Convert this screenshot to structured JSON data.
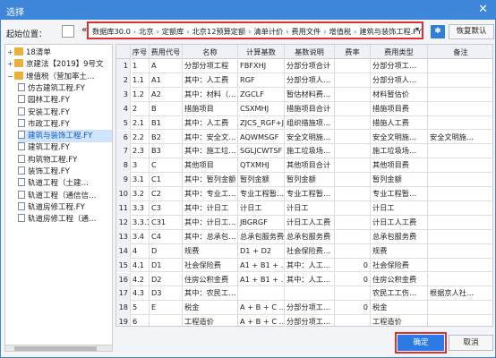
{
  "window": {
    "title": "选择",
    "close_glyph": "✕"
  },
  "path": {
    "label": "起始位置：",
    "arrow": "«",
    "crumbs": [
      "数据库30.0",
      "北京",
      "定额库",
      "北京12预算定额",
      "清单计价",
      "费用文件",
      "增值税",
      "建筑与装饰工程.FY"
    ],
    "separator": "›",
    "dropdown_glyph": "▾",
    "pin_glyph": "✱",
    "restore_label": "恢复默认"
  },
  "tree": {
    "items": [
      {
        "label": "18清单",
        "icon": "folder-icon",
        "level": 0,
        "expand": "+"
      },
      {
        "label": "京建法【2019】9号文",
        "icon": "folder-icon",
        "level": 0,
        "expand": "+"
      },
      {
        "label": "增值税（营加率土…",
        "icon": "folder-icon",
        "level": 0,
        "expand": "−"
      },
      {
        "label": "仿古建筑工程.FY",
        "icon": "file-icon",
        "level": 1
      },
      {
        "label": "园林工程.FY",
        "icon": "file-icon",
        "level": 1
      },
      {
        "label": "安装工程.FY",
        "icon": "file-icon",
        "level": 1
      },
      {
        "label": "市政工程.FY",
        "icon": "file-icon",
        "level": 1
      },
      {
        "label": "建筑与装饰工程.FY",
        "icon": "file-icon",
        "level": 1,
        "selected": true
      },
      {
        "label": "建筑工程.FY",
        "icon": "file-icon",
        "level": 1
      },
      {
        "label": "构筑物工程.FY",
        "icon": "file-icon",
        "level": 1
      },
      {
        "label": "装饰工程.FY",
        "icon": "file-icon",
        "level": 1
      },
      {
        "label": "轨道工程（土建…",
        "icon": "file-icon",
        "level": 1
      },
      {
        "label": "轨道工程（通信信…",
        "icon": "file-icon",
        "level": 1
      },
      {
        "label": "轨道房修工程.FY",
        "icon": "file-icon",
        "level": 1
      },
      {
        "label": "轨道房修工程（通…",
        "icon": "file-icon",
        "level": 1
      }
    ]
  },
  "grid": {
    "columns": [
      "序号",
      "费用代号",
      "名称",
      "计算基数",
      "基数说明",
      "费率",
      "费用类型",
      "备注"
    ],
    "rows": [
      [
        "1",
        "1",
        "A",
        "分部分项工程",
        "FBFXHJ",
        "分部分项合计",
        "",
        "分部分项工…",
        ""
      ],
      [
        "2",
        "1.1",
        "A1",
        "其中：人工费",
        "RGF",
        "分部分项人…",
        "",
        "分部分项人…",
        ""
      ],
      [
        "3",
        "1.2",
        "A2",
        "其中：材料（…",
        "ZGCLF",
        "暂估材料费…",
        "",
        "材料暂估价",
        ""
      ],
      [
        "4",
        "2",
        "B",
        "措施项目",
        "CSXMHJ",
        "措施项目合计",
        "",
        "措施项目费",
        ""
      ],
      [
        "5",
        "2.1",
        "B1",
        "其中：人工费",
        "ZJCS_RGF+J…",
        "组织措施项…",
        "",
        "措施人工费",
        ""
      ],
      [
        "6",
        "2.2",
        "B2",
        "其中：安全文…",
        "AQWMSGF",
        "安全文明施…",
        "",
        "安全文明施…",
        "安全文明施…"
      ],
      [
        "7",
        "2.3",
        "B3",
        "其中：施工垃…",
        "SGLJCWTSF",
        "施工垃圾场…",
        "",
        "施工垃圾场…",
        ""
      ],
      [
        "8",
        "3",
        "C",
        "其他项目",
        "QTXMHJ",
        "其他项目合计",
        "",
        "其他项目费",
        ""
      ],
      [
        "9",
        "3.1",
        "C1",
        "其中：暂列金额",
        "暂列金额",
        "暂列金额",
        "",
        "暂列金额",
        ""
      ],
      [
        "10",
        "3.2",
        "C2",
        "其中：专业工…",
        "专业工程暂…",
        "专业工程暂…",
        "",
        "专业工程暂…",
        ""
      ],
      [
        "11",
        "3.3",
        "C3",
        "其中：计日工",
        "计日工",
        "计日工",
        "",
        "计日工",
        ""
      ],
      [
        "12",
        "3.3.1",
        "C31",
        "其中：计日工…",
        "JBGRGF",
        "计日工人工费",
        "",
        "计日工人工费",
        ""
      ],
      [
        "13",
        "3.4",
        "C4",
        "其中：总承包…",
        "总承包服务费",
        "总承包服务费",
        "",
        "总承包服务费",
        ""
      ],
      [
        "14",
        "4",
        "D",
        "规费",
        "D1 + D2",
        "社会保险费…",
        "",
        "规费",
        ""
      ],
      [
        "15",
        "4.1",
        "D1",
        "社会保险费",
        "A1 + B1 + …",
        "其中：人工…",
        "0",
        "社会保险费",
        ""
      ],
      [
        "16",
        "4.2",
        "D2",
        "住房公积金费",
        "A1 + B1 + …",
        "其中：人工…",
        "0",
        "住房公积金费",
        ""
      ],
      [
        "17",
        "4.3",
        "D3",
        "其中：农民工…",
        "",
        "",
        "",
        "农民工工伤…",
        "根据京人社…"
      ],
      [
        "18",
        "5",
        "E",
        "税金",
        "A + B + C …",
        "分部分项工…",
        "0",
        "税金",
        ""
      ],
      [
        "19",
        "6",
        "",
        "工程造价",
        "A + B + C …",
        "分部分项工…",
        "",
        "工程造价",
        ""
      ]
    ]
  },
  "footer": {
    "ok_label": "确定",
    "cancel_label": "取消"
  }
}
